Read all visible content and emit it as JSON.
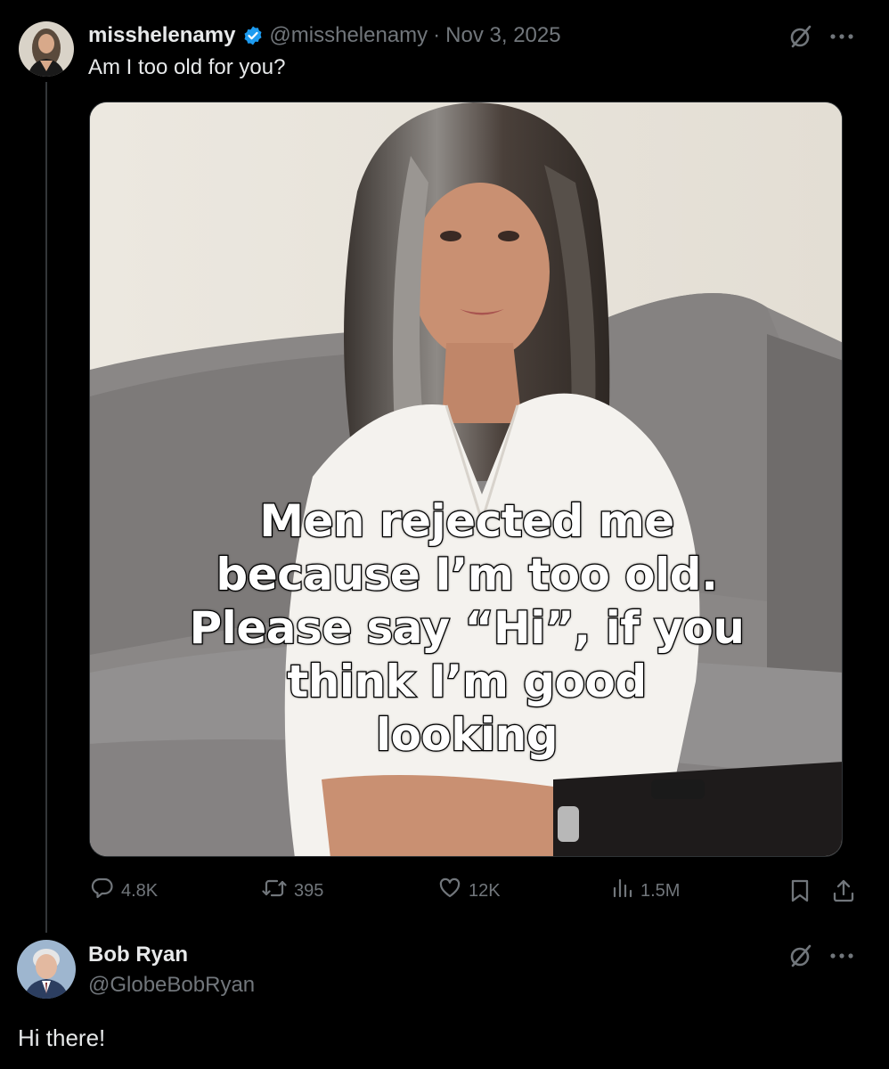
{
  "tweet": {
    "author_name": "misshelenamy",
    "author_handle": "@misshelenamy",
    "separator": "·",
    "date": "Nov 3, 2025",
    "text": "Am I too old for you?",
    "media_caption_lines": [
      "Men rejected me",
      "because I’m too old.",
      "Please say “Hi”, if you",
      "think I’m good",
      "looking"
    ],
    "stats": {
      "replies": "4.8K",
      "reposts": "395",
      "likes": "12K",
      "views": "1.5M"
    }
  },
  "reply": {
    "author_name": "Bob Ryan",
    "author_handle": "@GlobeBobRyan",
    "text": "Hi there!"
  },
  "icons": {
    "verified": "verified-badge-icon",
    "grok": "grok-icon",
    "more": "more-icon",
    "reply": "reply-icon",
    "repost": "repost-icon",
    "like": "like-icon",
    "views": "views-icon",
    "bookmark": "bookmark-icon",
    "share": "share-icon"
  },
  "colors": {
    "background": "#000000",
    "text_primary": "#e7e9ea",
    "text_secondary": "#71767b",
    "verified_blue": "#1d9bf0",
    "thread_line": "#333639"
  }
}
